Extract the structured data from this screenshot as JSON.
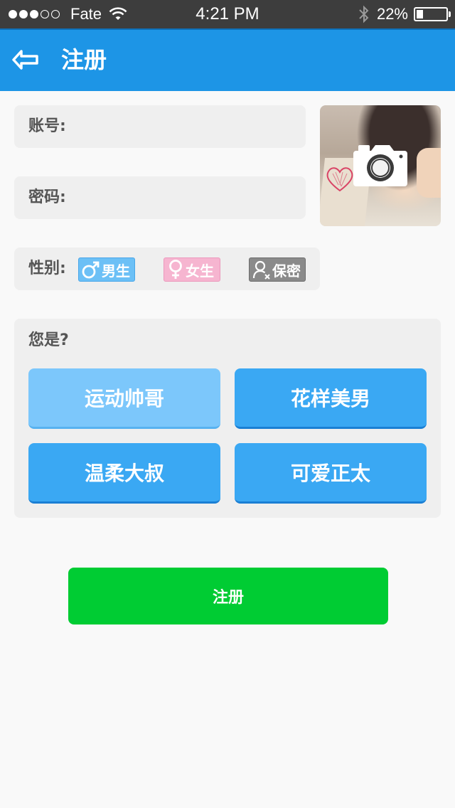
{
  "status_bar": {
    "carrier": "Fate",
    "time": "4:21 PM",
    "battery": "22%",
    "battery_level": 0.22,
    "signal_dots_filled": 3,
    "signal_dots_total": 5
  },
  "nav": {
    "title": "注册",
    "back_icon": "back-arrow-icon",
    "color": "#1d95e6"
  },
  "form": {
    "account": {
      "label": "账号:",
      "value": "",
      "placeholder": ""
    },
    "password": {
      "label": "密码:",
      "value": "",
      "placeholder": ""
    }
  },
  "avatar": {
    "icon": "camera-icon"
  },
  "gender": {
    "label": "性别:",
    "options": [
      {
        "label": "男生",
        "icon": "male-symbol-icon",
        "color": "#6cc0f6"
      },
      {
        "label": "女生",
        "icon": "female-symbol-icon",
        "color": "#f6b5d0"
      },
      {
        "label": "保密",
        "icon": "person-secret-icon",
        "color": "#8a8a8a"
      }
    ]
  },
  "identity": {
    "question": "您是?",
    "types": [
      {
        "label": "运动帅哥",
        "selected": true
      },
      {
        "label": "花样美男",
        "selected": false
      },
      {
        "label": "温柔大叔",
        "selected": false
      },
      {
        "label": "可爱正太",
        "selected": false
      }
    ]
  },
  "register_button": {
    "label": "注册",
    "color": "#00cc33"
  }
}
